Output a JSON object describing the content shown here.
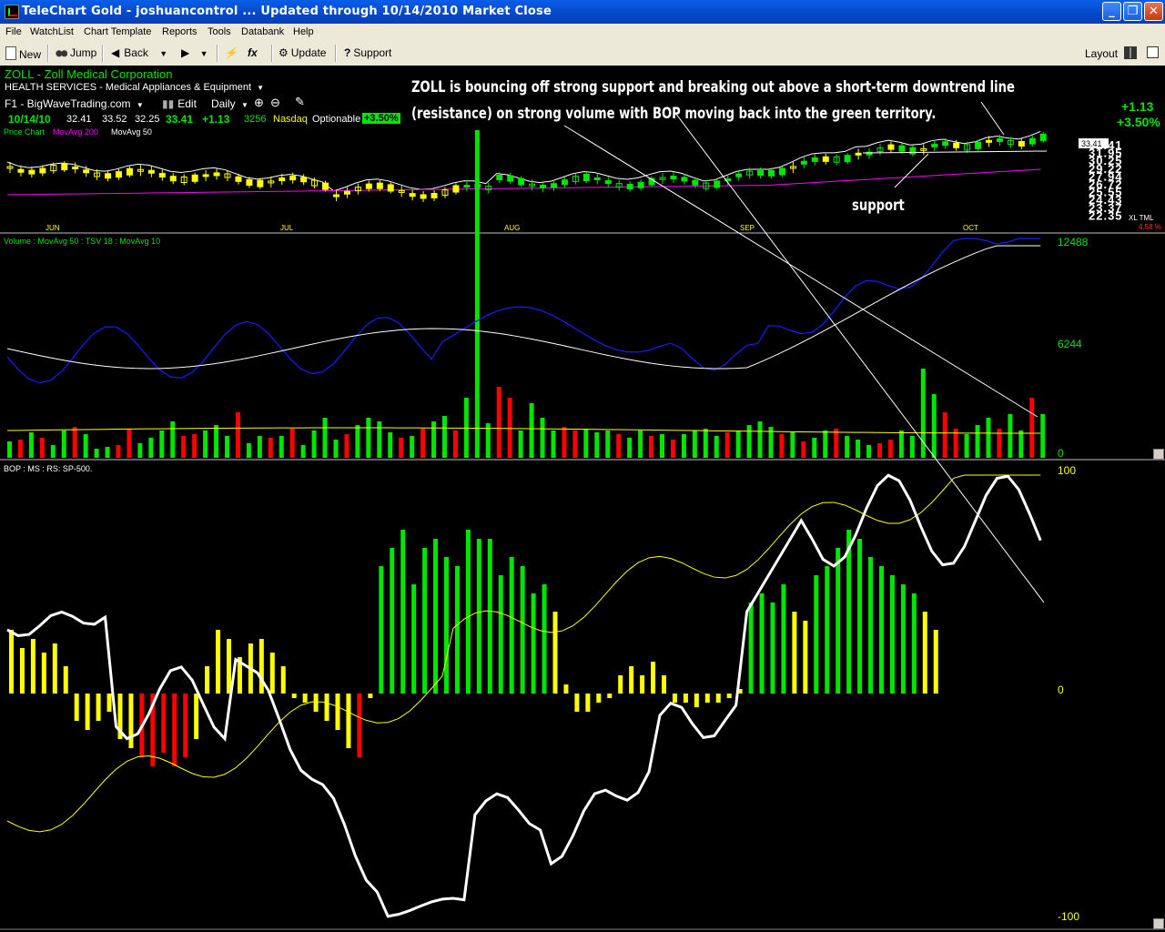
{
  "window": {
    "title": "TeleChart Gold - joshuancontrol  ... Updated through 10/14/2010  Market Close",
    "minimize": "_",
    "maximize": "❐",
    "close": "✕"
  },
  "menu": [
    "File",
    "WatchList",
    "Chart Template",
    "Reports",
    "Tools",
    "Databank",
    "Help"
  ],
  "toolbar": {
    "new": "New",
    "jump": "Jump",
    "back": "Back",
    "update": "Update",
    "support": "Support",
    "layout": "Layout",
    "fx": "fx"
  },
  "header": {
    "symbol_line": "ZOLL  -  Zoll Medical Corporation",
    "industry": "HEALTH SERVICES - Medical Appliances & Equipment",
    "watchlist": "F1 - BigWaveTrading.com",
    "edit": "Edit",
    "period": "Daily",
    "date": "10/14/10",
    "open": "32.41",
    "high": "33.52",
    "low": "32.25",
    "close": "33.41",
    "change": "+1.13",
    "volume": "3256",
    "exchange": "Nasdaq",
    "optionable": "Optionable",
    "pct_badge": "+3.50%",
    "right_change": "+1.13",
    "right_pct": "+3.50%"
  },
  "annotations": {
    "line1": "ZOLL is bouncing off strong support and breaking out above a short-term downtrend line",
    "line2": "(resistance) on strong volume with BOP moving back into the green territory.",
    "support": "support"
  },
  "price_panel": {
    "legend_label": "Price Chart",
    "ma200": "MovAvg 200",
    "ma50": "MovAvg 50",
    "last_tag": "33.41",
    "axis_labels": [
      "32.41",
      "31.95",
      "30.25",
      "29.22",
      "27.94",
      "26.72",
      "25.55",
      "24.43",
      "23.37",
      "22.35"
    ],
    "month_labels": [
      "JUN",
      "JUL",
      "AUG",
      "SEP",
      "OCT"
    ],
    "scale_note": "4.58 %",
    "scale_flags": "XL TML"
  },
  "volume_panel": {
    "legend": "Volume : MovAvg 50 : TSV 18 : MovAvg 10",
    "axis_top": "12488",
    "axis_mid": "6244",
    "axis_zero": "0"
  },
  "bop_panel": {
    "legend": "BOP : MS : RS: SP-500.",
    "axis_top": "100",
    "axis_zero": "0",
    "axis_bottom": "-100"
  },
  "colors": {
    "up": "#00e600",
    "down": "#ff0000",
    "neutral": "#ffff00",
    "ma200": "#ff00ff",
    "tsv": "#1a1aff",
    "titlebar": "#0a5ee8",
    "chrome": "#ece9d8"
  }
}
